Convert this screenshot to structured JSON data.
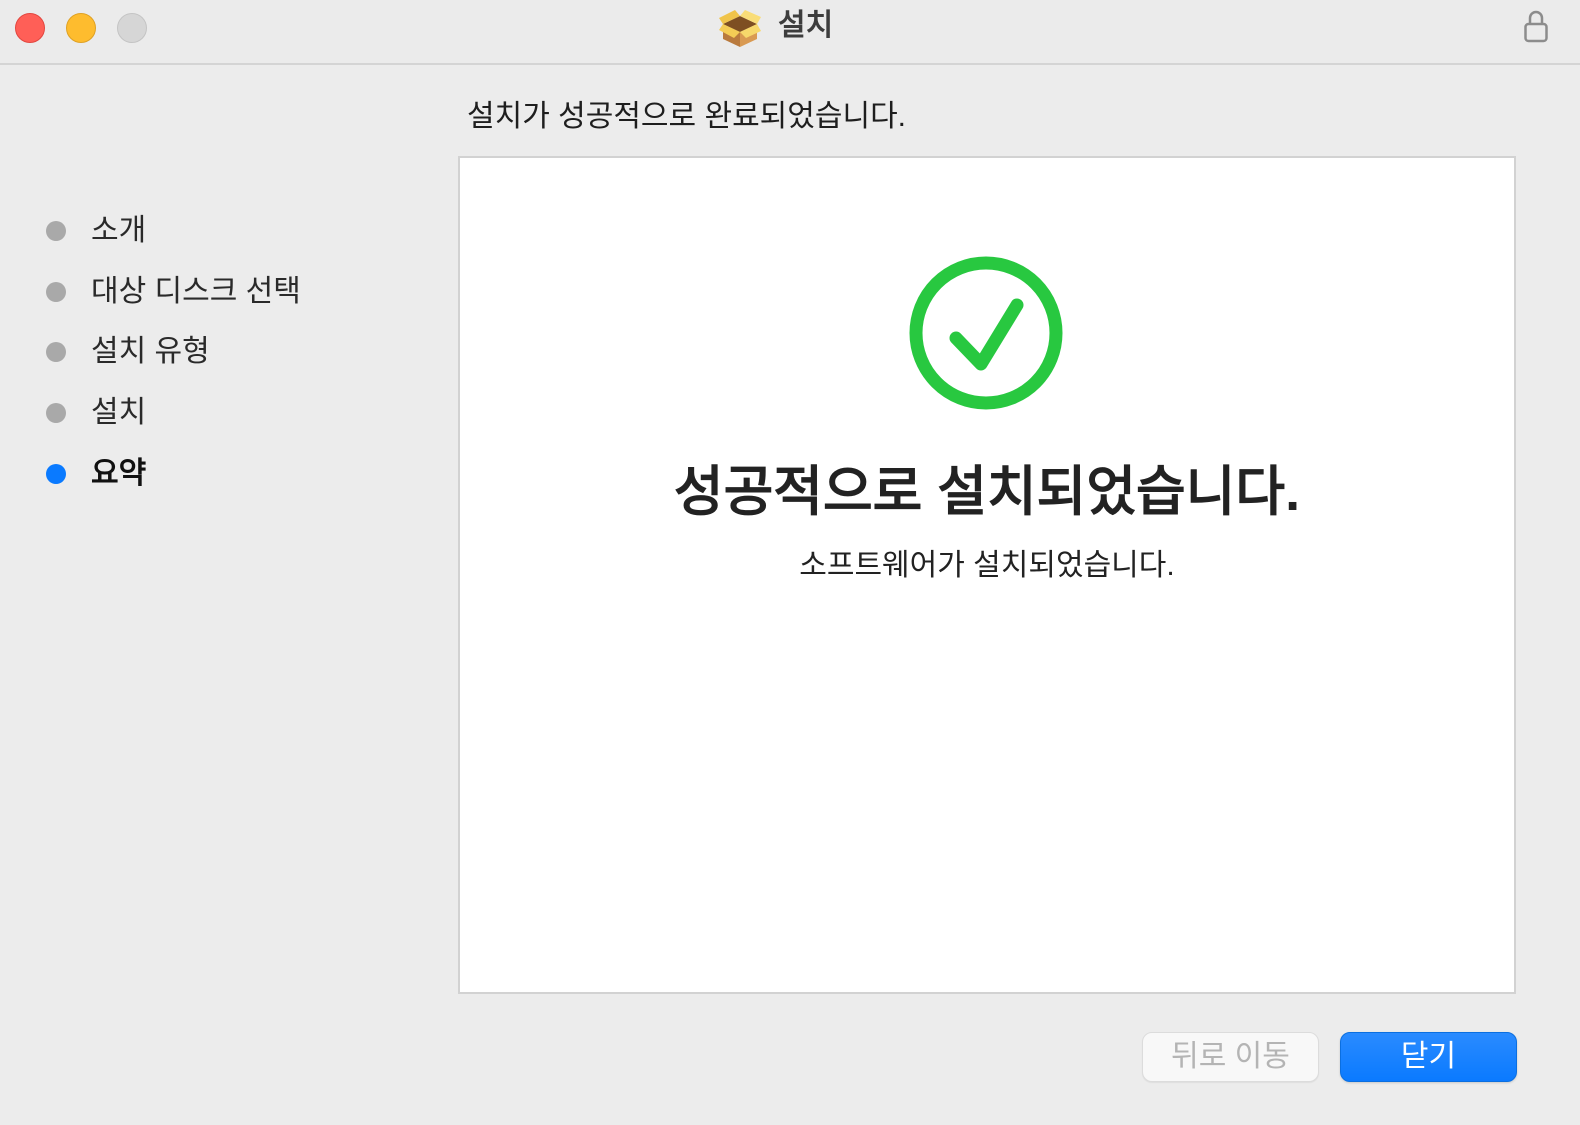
{
  "window": {
    "title": "설치",
    "title_icon": "package-icon",
    "lock_icon": "lock-icon"
  },
  "header": {
    "title": "설치가 성공적으로 완료되었습니다."
  },
  "sidebar": {
    "steps": [
      {
        "label": "소개",
        "active": false
      },
      {
        "label": "대상 디스크 선택",
        "active": false
      },
      {
        "label": "설치 유형",
        "active": false
      },
      {
        "label": "설치",
        "active": false
      },
      {
        "label": "요약",
        "active": true
      }
    ]
  },
  "content": {
    "status_icon": "checkmark-circle-icon",
    "heading": "성공적으로 설치되었습니다.",
    "message": "소프트웨어가 설치되었습니다."
  },
  "footer": {
    "back_button": {
      "label": "뒤로 이동",
      "enabled": false
    },
    "close_button": {
      "label": "닫기",
      "enabled": true
    }
  },
  "colors": {
    "window_background": "#ececec",
    "accent": "#0a7aff",
    "step_inactive": "#a9a9a9",
    "success": "#28c840",
    "close_light": "#ff5f57",
    "minimize_light": "#febc2e",
    "zoom_light": "#d6d6d6"
  }
}
